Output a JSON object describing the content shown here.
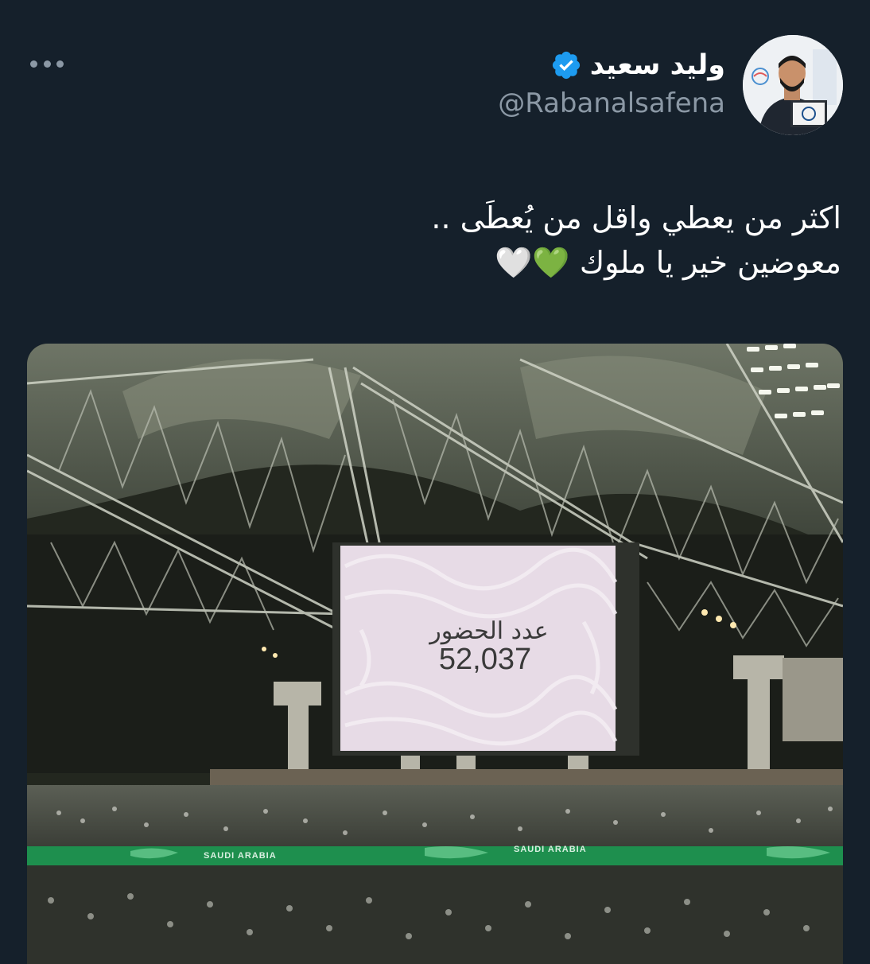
{
  "tweet": {
    "display_name": "وليد سعيد",
    "handle": "@Rabanalsafena",
    "text_line1": "اكثر من يعطي واقل من يُعطَى ..",
    "text_line2": "معوضين خير يا ملوك 💚🤍"
  },
  "icons": {
    "more": "more-horizontal-icon",
    "verified": "verified-badge-icon"
  },
  "media": {
    "screen_label": "عدد الحضور",
    "screen_count": "52,037",
    "banner_left": "SAUDI ARABIA",
    "banner_right": "SAUDI ARABIA"
  },
  "colors": {
    "background": "#15202b",
    "secondary_text": "#8b98a5",
    "verified_blue": "#1d9bf0",
    "pitch_banner_green": "#1e8f4e"
  }
}
